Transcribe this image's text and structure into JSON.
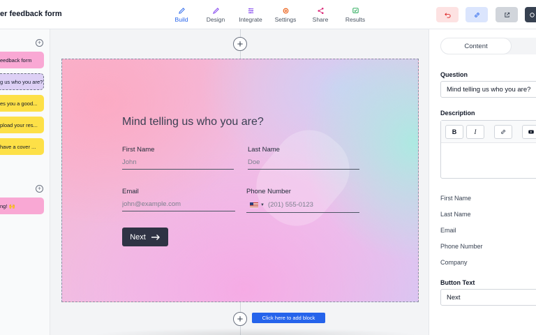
{
  "header": {
    "form_title": "er feedback form",
    "tabs": [
      {
        "label": "Build",
        "icon": "pencil-icon",
        "active": true
      },
      {
        "label": "Design",
        "icon": "brush-icon",
        "active": false
      },
      {
        "label": "Integrate",
        "icon": "sliders-icon",
        "active": false
      },
      {
        "label": "Settings",
        "icon": "gear-icon",
        "active": false
      },
      {
        "label": "Share",
        "icon": "share-icon",
        "active": false
      },
      {
        "label": "Results",
        "icon": "results-icon",
        "active": false
      }
    ],
    "tools": [
      {
        "icon": "undo-icon",
        "bg": "#fde2e2",
        "color": "#dc2626"
      },
      {
        "icon": "link-icon",
        "bg": "#dbe5fd",
        "color": "#2563eb"
      },
      {
        "icon": "external-link-icon",
        "bg": "#d1d5db",
        "color": "#374151"
      },
      {
        "icon": "publish-icon",
        "bg": "#374151",
        "color": "#ffffff"
      }
    ]
  },
  "sidebar": {
    "blocks": [
      {
        "label": "eedback form",
        "color": "#f9a8d4"
      },
      {
        "label": "g us who you are?",
        "color": "#ddd0f5"
      },
      {
        "label": "es you a good...",
        "color": "#fde047"
      },
      {
        "label": "pload your res...",
        "color": "#fde047"
      },
      {
        "label": "have a cover ...",
        "color": "#fde047"
      }
    ],
    "ending_blocks": [
      {
        "label": "ng! 🙌",
        "color": "#f9a8d4"
      }
    ]
  },
  "canvas": {
    "question": "Mind telling us who you are?",
    "fields": {
      "first_name": {
        "label": "First Name",
        "placeholder": "John"
      },
      "last_name": {
        "label": "Last Name",
        "placeholder": "Doe"
      },
      "email": {
        "label": "Email",
        "placeholder": "john@example.com"
      },
      "phone": {
        "label": "Phone Number",
        "placeholder": "(201) 555-0123"
      }
    },
    "next_label": "Next",
    "add_block_label": "Click here to add block"
  },
  "panel": {
    "tab_content": "Content",
    "question_label": "Question",
    "question_value": "Mind telling us who you are?",
    "description_label": "Description",
    "editor_buttons": [
      "B",
      "I"
    ],
    "field_list": [
      "First Name",
      "Last Name",
      "Email",
      "Phone Number",
      "Company"
    ],
    "button_text_label": "Button Text",
    "button_text_value": "Next"
  }
}
